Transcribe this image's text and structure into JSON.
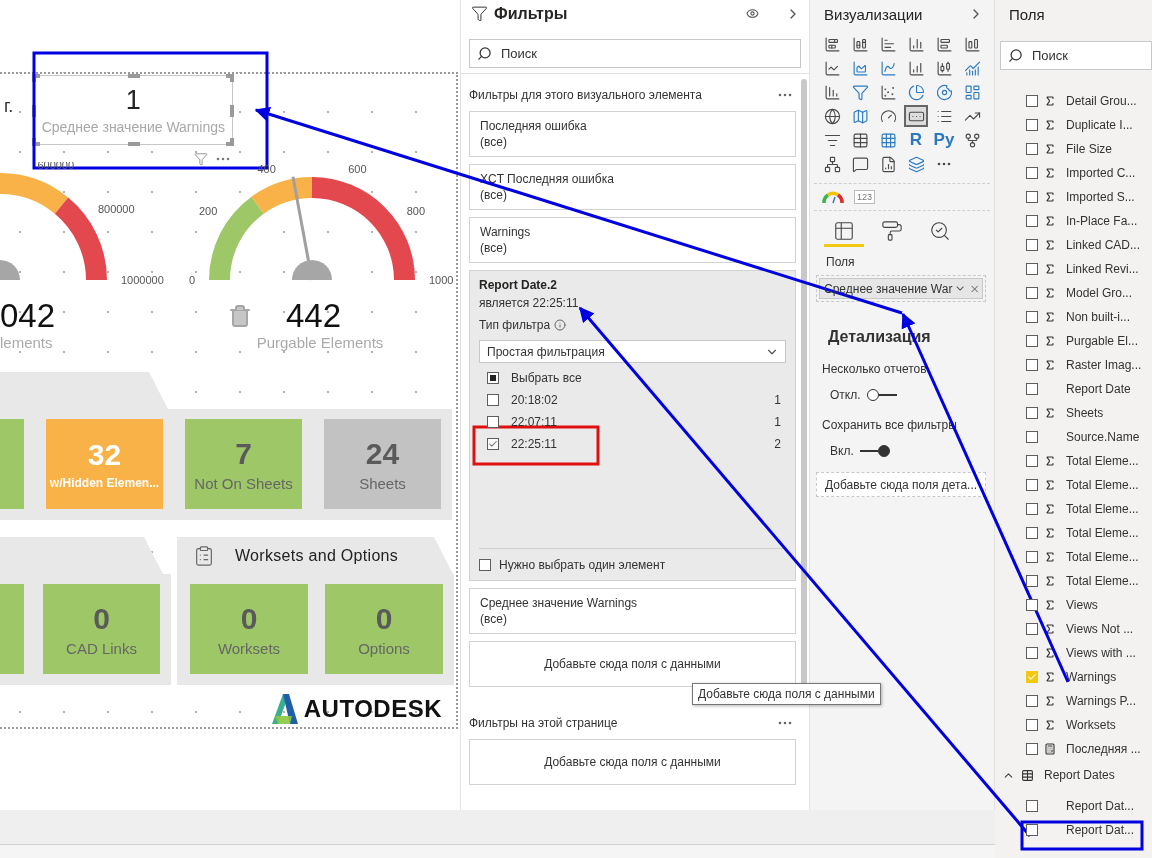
{
  "canvas": {
    "date_fragment": "г.",
    "card": {
      "value": "1",
      "label": "Среднее значение Warnings",
      "selected": true
    },
    "gauges": [
      {
        "ticks": [
          "600000",
          "800000",
          "1000000"
        ],
        "value": "042",
        "label": "lements"
      },
      {
        "ticks": [
          "0",
          "200",
          "400",
          "600",
          "800",
          "1000"
        ],
        "value": "442",
        "label": "Purgable Elements",
        "level": 0.442
      }
    ],
    "tile_rows": [
      {
        "groups": [
          {
            "tiles": [
              {
                "kind": "partial",
                "color": "#9ec867"
              },
              {
                "kind": "warning",
                "value": "32",
                "label": "w/Hidden Elemen...",
                "color": "#f9b247"
              },
              {
                "kind": "metric",
                "value": "7",
                "label": "Not On Sheets",
                "color": "#9ec867"
              },
              {
                "kind": "metric",
                "value": "24",
                "label": "Sheets",
                "color": "#c2c2c2"
              }
            ]
          }
        ]
      },
      {
        "groups": [
          {
            "tiles": [
              {
                "kind": "partial",
                "color": "#9ec867"
              },
              {
                "kind": "metric",
                "value": "0",
                "label": "CAD Links",
                "color": "#9ec867"
              }
            ]
          },
          {
            "title": "Worksets and Options",
            "tiles": [
              {
                "kind": "metric",
                "value": "0",
                "label": "Worksets",
                "color": "#9ec867"
              },
              {
                "kind": "metric",
                "value": "0",
                "label": "Options",
                "color": "#9ec867"
              }
            ]
          }
        ]
      }
    ],
    "logo": "AUTODESK"
  },
  "filters": {
    "title": "Фильтры",
    "search": {
      "placeholder": "Поиск"
    },
    "sections": [
      {
        "title": "Фильтры для этого визуального элемента",
        "cards": [
          {
            "kind": "collapsed",
            "field": "Последняя ошибка",
            "summary": "(все)"
          },
          {
            "kind": "collapsed",
            "field": "XCT Последняя ошибка",
            "summary": "(все)"
          },
          {
            "kind": "collapsed",
            "field": "Warnings",
            "summary": "(все)"
          },
          {
            "kind": "expanded",
            "field": "Report Date.2",
            "summary": "является 22:25:11",
            "type_label": "Тип фильтра",
            "type_value": "Простая фильтрация",
            "options": [
              {
                "kind": "all",
                "label": "Выбрать все",
                "checked": false,
                "partial": true
              },
              {
                "kind": "value",
                "label": "20:18:02",
                "count": "1",
                "checked": false
              },
              {
                "kind": "value",
                "label": "22:07:11",
                "count": "1",
                "checked": false
              },
              {
                "kind": "value",
                "label": "22:25:11",
                "count": "2",
                "checked": true
              }
            ],
            "require_single": {
              "label": "Нужно выбрать один элемент",
              "checked": false
            }
          },
          {
            "kind": "collapsed",
            "field": "Среднее значение Warnings",
            "summary": "(все)"
          },
          {
            "kind": "dropzone",
            "text": "Добавьте сюда поля с данными"
          }
        ]
      },
      {
        "title": "Фильтры на этой странице",
        "cards": [
          {
            "kind": "dropzone",
            "text": "Добавьте сюда поля с данными"
          }
        ]
      }
    ],
    "tooltip": "Добавьте сюда поля с данными"
  },
  "visualizations": {
    "title": "Визуализации",
    "visuals": [
      {
        "kind": "icon",
        "selected": false
      },
      {
        "kind": "icon",
        "selected": false
      },
      {
        "kind": "icon",
        "selected": false
      },
      {
        "kind": "icon",
        "selected": false
      },
      {
        "kind": "icon",
        "selected": false
      },
      {
        "kind": "icon",
        "selected": false
      },
      {
        "kind": "icon",
        "selected": false
      },
      {
        "kind": "icon",
        "selected": false
      },
      {
        "kind": "icon",
        "selected": false
      },
      {
        "kind": "icon",
        "selected": false
      },
      {
        "kind": "icon",
        "selected": false
      },
      {
        "kind": "icon",
        "selected": false
      },
      {
        "kind": "icon",
        "selected": false
      },
      {
        "kind": "icon",
        "selected": false
      },
      {
        "kind": "icon",
        "selected": false
      },
      {
        "kind": "icon",
        "selected": false
      },
      {
        "kind": "icon",
        "selected": false
      },
      {
        "kind": "icon",
        "selected": false
      },
      {
        "kind": "icon",
        "selected": false
      },
      {
        "kind": "icon",
        "selected": false
      },
      {
        "kind": "icon",
        "selected": false
      },
      {
        "kind": "icon",
        "selected": true
      },
      {
        "kind": "icon",
        "selected": false
      },
      {
        "kind": "icon",
        "selected": false
      },
      {
        "kind": "icon",
        "selected": false
      },
      {
        "kind": "icon",
        "selected": false
      },
      {
        "kind": "icon",
        "selected": false
      },
      {
        "kind": "text",
        "label": "R",
        "selected": false
      },
      {
        "kind": "text",
        "label": "Py",
        "selected": false
      },
      {
        "kind": "icon",
        "selected": false
      },
      {
        "kind": "icon",
        "selected": false
      },
      {
        "kind": "icon",
        "selected": false
      },
      {
        "kind": "icon",
        "selected": false
      },
      {
        "kind": "icon",
        "selected": false
      },
      {
        "kind": "icon",
        "selected": false
      }
    ],
    "custom_visuals": [
      {
        "kind": "gauge"
      },
      {
        "kind": "number",
        "label": "123"
      }
    ],
    "tabs": [
      {
        "kind": "fields",
        "selected": true
      },
      {
        "kind": "format",
        "selected": false
      },
      {
        "kind": "analytics",
        "selected": false
      }
    ],
    "well_label": "Поля",
    "well_chip": "Среднее значение War",
    "drill": {
      "title": "Детализация",
      "settings": [
        {
          "label": "Несколько отчетов",
          "state": "Откл.",
          "on": false
        },
        {
          "label": "Сохранить все фильтры",
          "state": "Вкл.",
          "on": true
        }
      ],
      "dropzone": "Добавьте сюда поля дета..."
    }
  },
  "fields": {
    "title": "Поля",
    "search": {
      "placeholder": "Поиск"
    },
    "items": [
      {
        "kind": "sum",
        "label": "Detail Grou...",
        "checked": false
      },
      {
        "kind": "sum",
        "label": "Duplicate I...",
        "checked": false
      },
      {
        "kind": "sum",
        "label": "File Size",
        "checked": false
      },
      {
        "kind": "sum",
        "label": "Imported C...",
        "checked": false
      },
      {
        "kind": "sum",
        "label": "Imported S...",
        "checked": false
      },
      {
        "kind": "sum",
        "label": "In-Place Fa...",
        "checked": false
      },
      {
        "kind": "sum",
        "label": "Linked CAD...",
        "checked": false
      },
      {
        "kind": "sum",
        "label": "Linked Revi...",
        "checked": false
      },
      {
        "kind": "sum",
        "label": "Model Gro...",
        "checked": false
      },
      {
        "kind": "sum",
        "label": "Non built-i...",
        "checked": false
      },
      {
        "kind": "sum",
        "label": "Purgable El...",
        "checked": false
      },
      {
        "kind": "sum",
        "label": "Raster Imag...",
        "checked": false
      },
      {
        "kind": "text",
        "label": "Report Date",
        "checked": false
      },
      {
        "kind": "sum",
        "label": "Sheets",
        "checked": false
      },
      {
        "kind": "text",
        "label": "Source.Name",
        "checked": false
      },
      {
        "kind": "sum",
        "label": "Total Eleme...",
        "checked": false
      },
      {
        "kind": "sum",
        "label": "Total Eleme...",
        "checked": false
      },
      {
        "kind": "sum",
        "label": "Total Eleme...",
        "checked": false
      },
      {
        "kind": "sum",
        "label": "Total Eleme...",
        "checked": false
      },
      {
        "kind": "sum",
        "label": "Total Eleme...",
        "checked": false
      },
      {
        "kind": "sum",
        "label": "Total Eleme...",
        "checked": false
      },
      {
        "kind": "sum",
        "label": "Views",
        "checked": false
      },
      {
        "kind": "sum",
        "label": "Views Not ...",
        "checked": false
      },
      {
        "kind": "sum",
        "label": "Views with ...",
        "checked": false
      },
      {
        "kind": "sum",
        "label": "Warnings",
        "checked": true
      },
      {
        "kind": "sum",
        "label": "Warnings P...",
        "checked": false
      },
      {
        "kind": "sum",
        "label": "Worksets",
        "checked": false
      },
      {
        "kind": "calc",
        "label": "Последняя ...",
        "checked": false
      }
    ],
    "tables": [
      {
        "name": "Report Dates",
        "expanded": true,
        "children": [
          {
            "label": "Report Dat...",
            "checked": false
          },
          {
            "label": "Report Dat...",
            "checked": false
          }
        ]
      }
    ]
  }
}
